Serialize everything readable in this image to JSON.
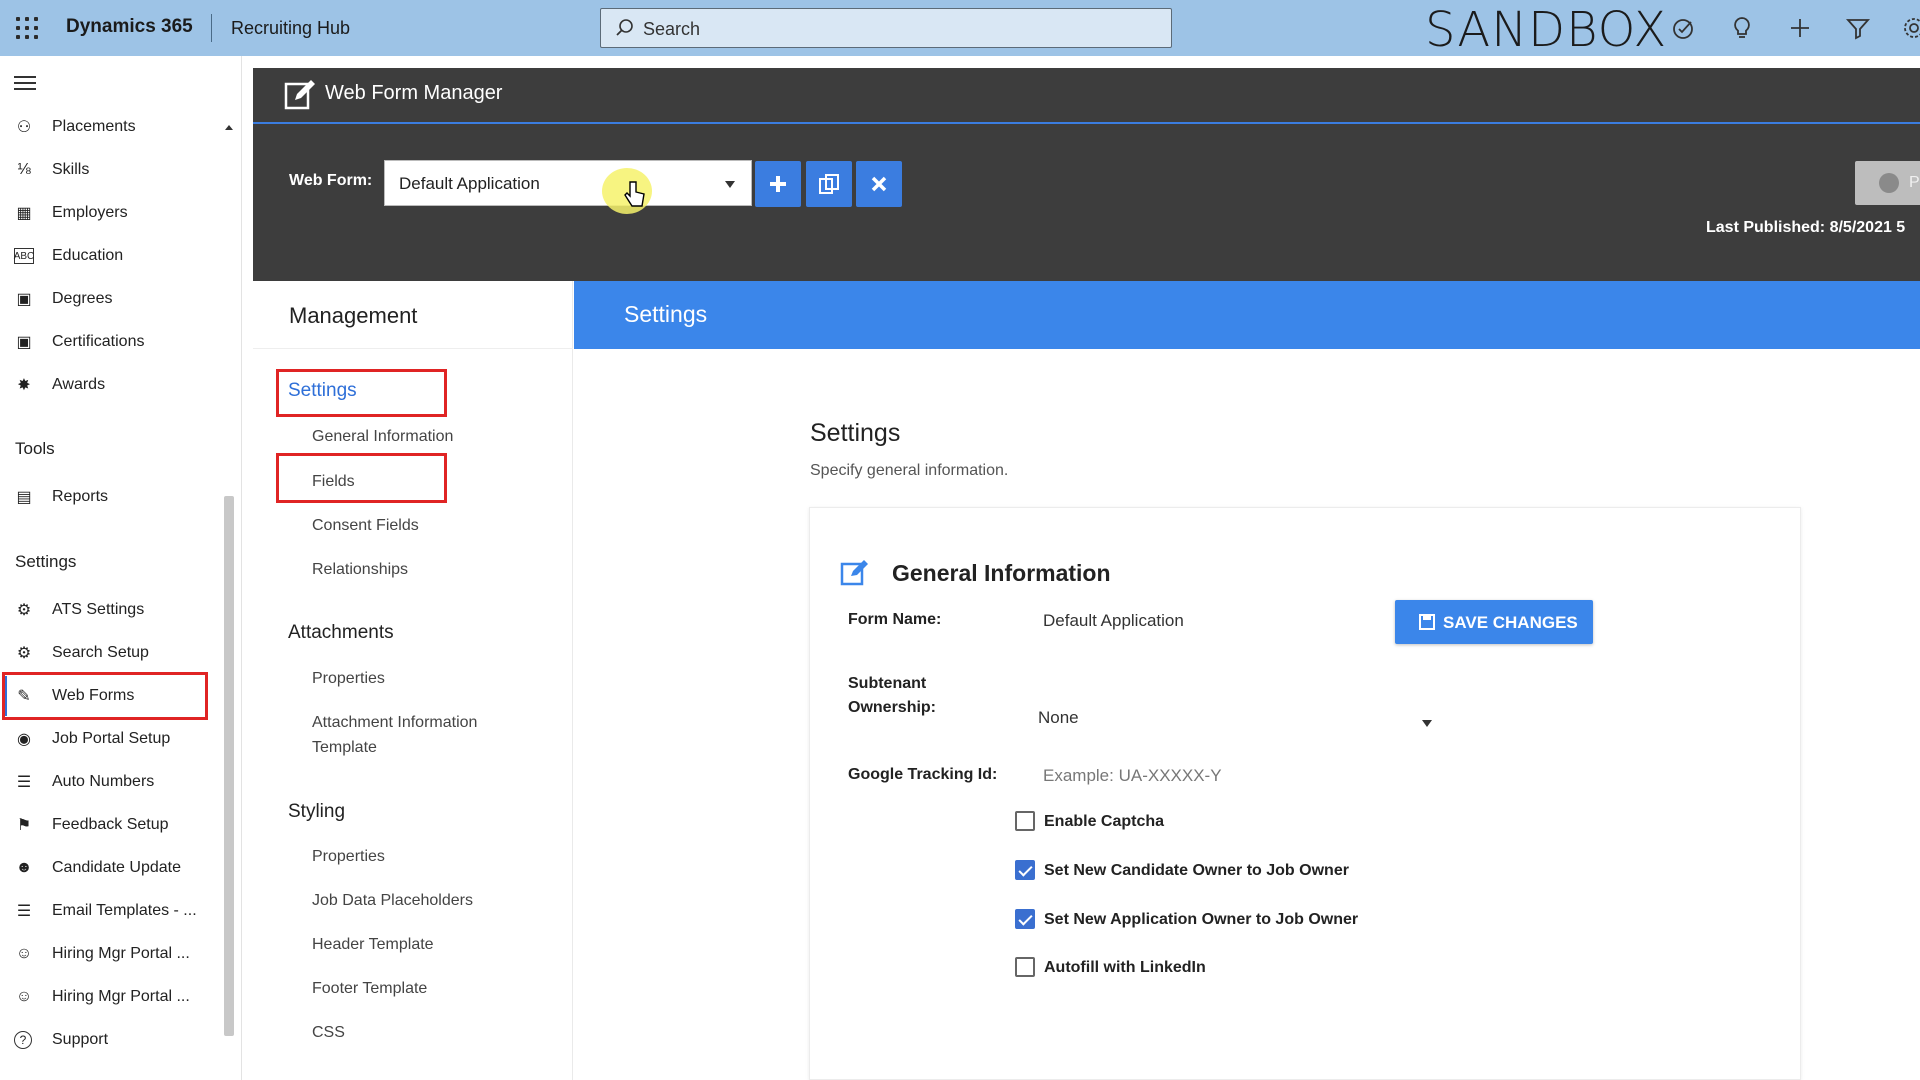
{
  "topbar": {
    "app_name": "Dynamics 365",
    "module": "Recruiting Hub",
    "search_placeholder": "Search",
    "environment": "SANDBOX",
    "icons": [
      "tasks-icon",
      "lightbulb-icon",
      "plus-icon",
      "filter-icon",
      "gear-icon"
    ]
  },
  "sidebar": {
    "items_top": [
      {
        "label": "Placements",
        "icon": "placements-icon"
      },
      {
        "label": "Skills",
        "icon": "skills-icon"
      },
      {
        "label": "Employers",
        "icon": "employers-icon"
      },
      {
        "label": "Education",
        "icon": "education-icon"
      },
      {
        "label": "Degrees",
        "icon": "degrees-icon"
      },
      {
        "label": "Certifications",
        "icon": "certifications-icon"
      },
      {
        "label": "Awards",
        "icon": "awards-icon"
      }
    ],
    "tools_header": "Tools",
    "tools_items": [
      {
        "label": "Reports",
        "icon": "reports-icon"
      }
    ],
    "settings_header": "Settings",
    "settings_items": [
      {
        "label": "ATS Settings",
        "icon": "gear-icon"
      },
      {
        "label": "Search Setup",
        "icon": "search-setup-icon"
      },
      {
        "label": "Web Forms",
        "icon": "web-forms-icon",
        "active": true
      },
      {
        "label": "Job Portal Setup",
        "icon": "globe-icon"
      },
      {
        "label": "Auto Numbers",
        "icon": "list-numbers-icon"
      },
      {
        "label": "Feedback Setup",
        "icon": "feedback-icon"
      },
      {
        "label": "Candidate Update",
        "icon": "candidate-update-icon"
      },
      {
        "label": "Email Templates - ...",
        "icon": "email-templates-icon"
      },
      {
        "label": "Hiring Mgr Portal ...",
        "icon": "hiring-mgr-icon"
      },
      {
        "label": "Hiring Mgr Portal ...",
        "icon": "hiring-mgr-2-icon"
      },
      {
        "label": "Support",
        "icon": "help-icon"
      }
    ]
  },
  "wfm": {
    "title": "Web Form Manager",
    "web_form_label": "Web Form:",
    "web_form_selected": "Default Application",
    "publish_label": "P",
    "last_published_label": "Last Published:",
    "last_published_value": "8/5/2021 5"
  },
  "management": {
    "title": "Management",
    "settings_link": "Settings",
    "settings_children": [
      "General Information",
      "Fields",
      "Consent Fields",
      "Relationships"
    ],
    "attachments_header": "Attachments",
    "attachments_children": [
      "Properties",
      "Attachment Information",
      "Template"
    ],
    "styling_header": "Styling",
    "styling_children": [
      "Properties",
      "Job Data Placeholders",
      "Header Template",
      "Footer Template",
      "CSS"
    ]
  },
  "content": {
    "header": "Settings",
    "title": "Settings",
    "subtitle": "Specify general information.",
    "section_title": "General Information",
    "form_name_label": "Form Name:",
    "form_name_value": "Default Application",
    "save_label": "SAVE CHANGES",
    "subtenant_label_1": "Subtenant",
    "subtenant_label_2": "Ownership:",
    "subtenant_value": "None",
    "tracking_label": "Google Tracking Id:",
    "tracking_placeholder": "Example: UA-XXXXX-Y",
    "checkboxes": [
      {
        "label": "Enable Captcha",
        "checked": false
      },
      {
        "label": "Set New Candidate Owner to Job Owner",
        "checked": true
      },
      {
        "label": "Set New Application Owner to Job Owner",
        "checked": true
      },
      {
        "label": "Autofill with LinkedIn",
        "checked": false
      }
    ]
  },
  "colors": {
    "topbar": "#9dc3e6",
    "dark_header": "#3d3d3d",
    "accent_blue": "#3b86ea",
    "highlight_red": "#e02424"
  }
}
